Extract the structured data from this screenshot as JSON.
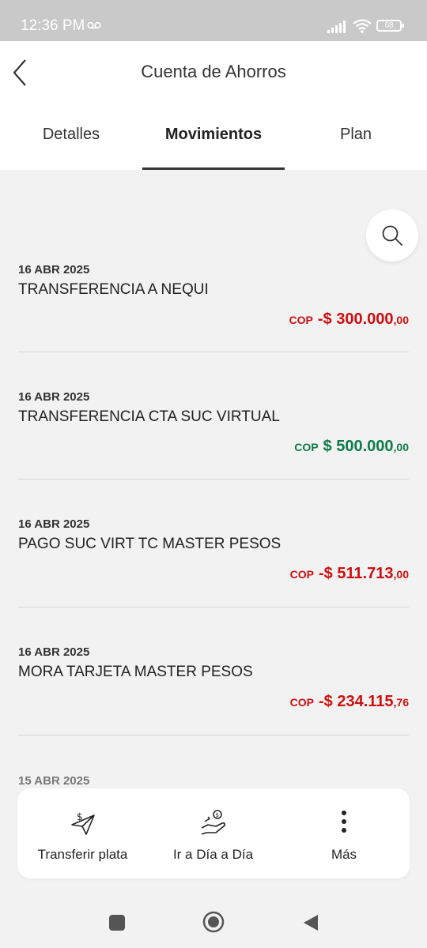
{
  "status_bar": {
    "time": "12:36 PM",
    "battery": "68"
  },
  "header": {
    "title": "Cuenta de Ahorros",
    "tabs": [
      {
        "label": "Detalles"
      },
      {
        "label": "Movimientos"
      },
      {
        "label": "Plan"
      }
    ],
    "active_tab": "Movimientos"
  },
  "transactions": [
    {
      "date": "16 ABR 2025",
      "description": "TRANSFERENCIA A NEQUI",
      "currency": "COP",
      "amount": "-$ 300.000",
      "cents": ",00",
      "type": "debit"
    },
    {
      "date": "16 ABR 2025",
      "description": "TRANSFERENCIA CTA SUC VIRTUAL",
      "currency": "COP",
      "amount": "$ 500.000",
      "cents": ",00",
      "type": "credit"
    },
    {
      "date": "16 ABR 2025",
      "description": "PAGO SUC VIRT TC MASTER PESOS",
      "currency": "COP",
      "amount": "-$ 511.713",
      "cents": ",00",
      "type": "debit"
    },
    {
      "date": "16 ABR 2025",
      "description": "MORA TARJETA MASTER PESOS",
      "currency": "COP",
      "amount": "-$ 234.115",
      "cents": ",76",
      "type": "debit"
    }
  ],
  "partial_date": "15 ABR 2025",
  "actions": [
    {
      "label": "Transferir plata",
      "icon": "send-money-icon"
    },
    {
      "label": "Ir a Día a Día",
      "icon": "hand-coin-icon"
    },
    {
      "label": "Más",
      "icon": "more-vertical-icon"
    }
  ],
  "colors": {
    "debit": "#cc1010",
    "credit": "#0e7a4a"
  }
}
